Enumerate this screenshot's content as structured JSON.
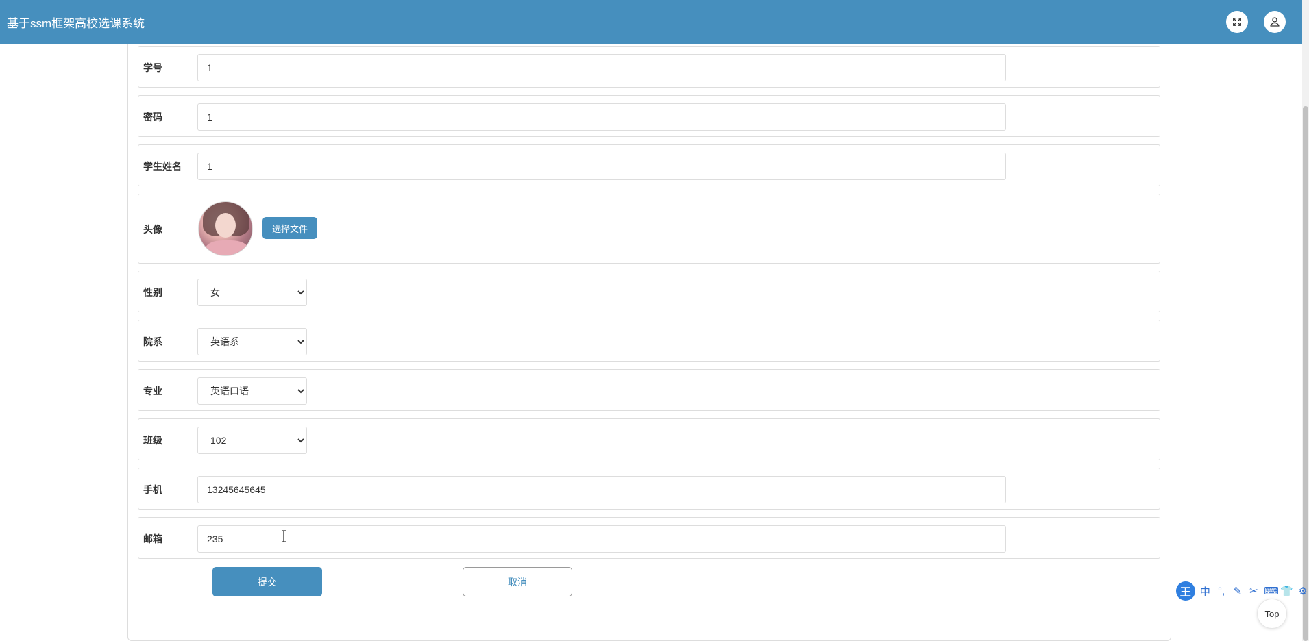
{
  "header": {
    "title": "基于ssm框架高校选课系统",
    "icons": [
      "fullscreen-icon",
      "user-icon"
    ]
  },
  "form": {
    "student_id": {
      "label": "学号",
      "value": "1"
    },
    "password": {
      "label": "密码",
      "value": "1"
    },
    "student_name": {
      "label": "学生姓名",
      "value": "1"
    },
    "avatar": {
      "label": "头像",
      "button": "选择文件"
    },
    "gender": {
      "label": "性别",
      "value": "女"
    },
    "department": {
      "label": "院系",
      "value": "英语系"
    },
    "major": {
      "label": "专业",
      "value": "英语口语"
    },
    "class": {
      "label": "班级",
      "value": "102"
    },
    "phone": {
      "label": "手机",
      "value": "13245645645"
    },
    "email": {
      "label": "邮箱",
      "value": "235"
    }
  },
  "actions": {
    "submit": "提交",
    "cancel": "取消"
  },
  "ime_toolbar": {
    "logo": "王",
    "mode": "中"
  },
  "back_to_top": "Top",
  "colors": {
    "primary": "#468fbe",
    "border": "#dddddd"
  }
}
